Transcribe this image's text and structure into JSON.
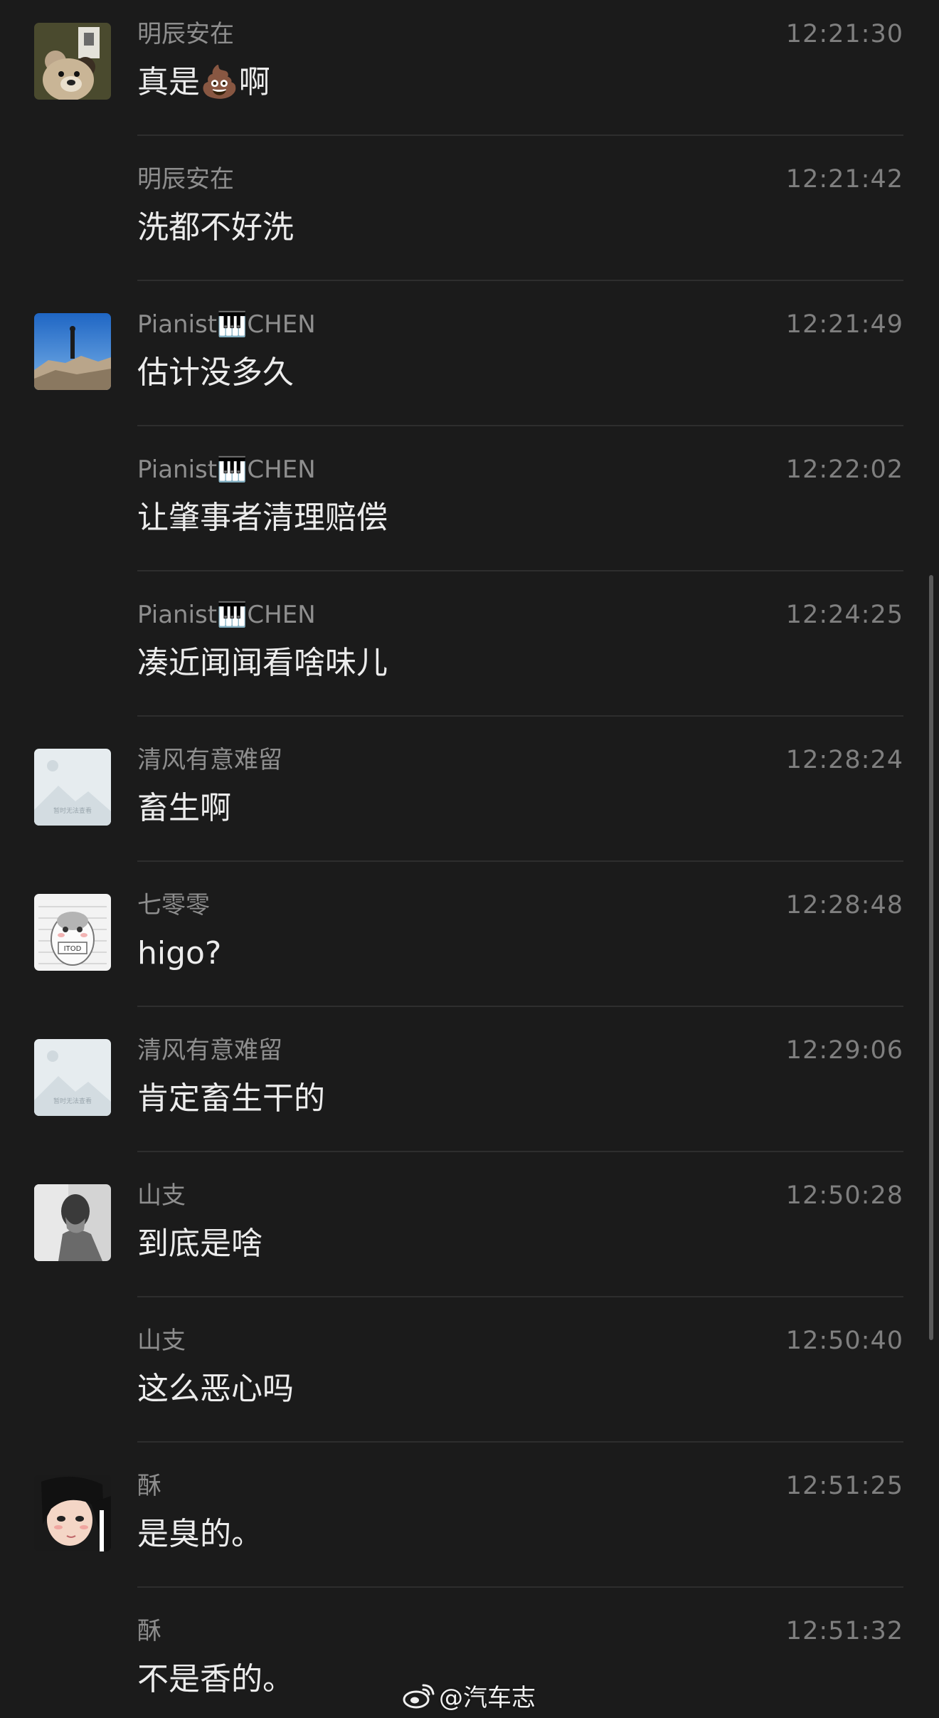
{
  "messages": [
    {
      "sender": "明辰安在",
      "time": "12:21:30",
      "text": "真是💩啊",
      "avatar": "teddy-bear-photo"
    },
    {
      "sender": "明辰安在",
      "time": "12:21:42",
      "text": "洗都不好洗",
      "avatar": null
    },
    {
      "sender": "Pianist🎹CHEN",
      "time": "12:21:49",
      "text": "估计没多久",
      "avatar": "mountain-photo"
    },
    {
      "sender": "Pianist🎹CHEN",
      "time": "12:22:02",
      "text": "让肇事者清理赔偿",
      "avatar": null
    },
    {
      "sender": "Pianist🎹CHEN",
      "time": "12:24:25",
      "text": "凑近闻闻看啥味儿",
      "avatar": null
    },
    {
      "sender": "清风有意难留",
      "time": "12:28:24",
      "text": "畜生啊",
      "avatar": "placeholder-image"
    },
    {
      "sender": "七零零",
      "time": "12:28:48",
      "text": "higo?",
      "avatar": "hamster-cartoon"
    },
    {
      "sender": "清风有意难留",
      "time": "12:29:06",
      "text": "肯定畜生干的",
      "avatar": "placeholder-image"
    },
    {
      "sender": "山支",
      "time": "12:50:28",
      "text": "到底是啥",
      "avatar": "portrait-bw"
    },
    {
      "sender": "山支",
      "time": "12:50:40",
      "text": "这么恶心吗",
      "avatar": null
    },
    {
      "sender": "酥",
      "time": "12:51:25",
      "text": "是臭的。",
      "avatar": "anime-girl"
    },
    {
      "sender": "酥",
      "time": "12:51:32",
      "text": "不是香的。",
      "avatar": null
    }
  ],
  "placeholder_avatar_caption": "暂时无法查看",
  "hamster_caption": "ITOD",
  "watermark": "@汽车志",
  "colors": {
    "background": "#1b1b1b",
    "sender": "#8e8e8e",
    "time": "#7f7f7f",
    "text": "#ececec",
    "divider": "#2e2e2e"
  }
}
